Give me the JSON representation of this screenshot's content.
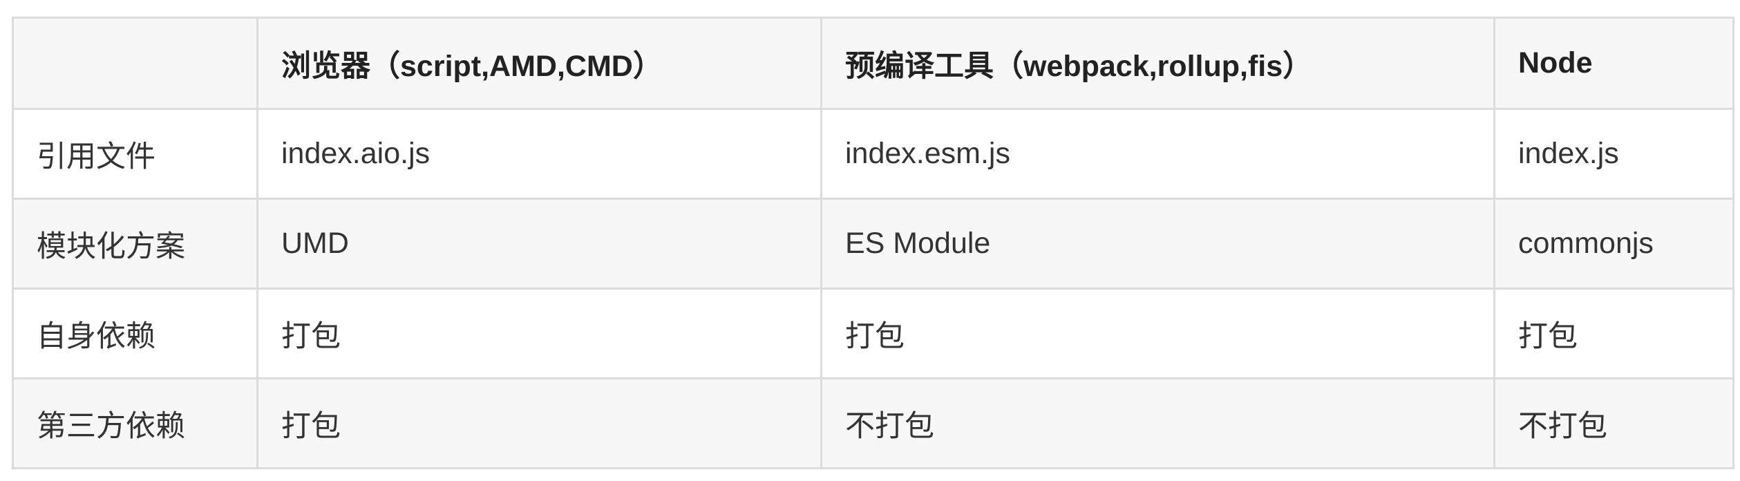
{
  "table": {
    "headers": [
      "",
      "浏览器（script,AMD,CMD）",
      "预编译工具（webpack,rollup,fis）",
      "Node"
    ],
    "rows": [
      [
        "引用文件",
        "index.aio.js",
        "index.esm.js",
        "index.js"
      ],
      [
        "模块化方案",
        "UMD",
        "ES Module",
        "commonjs"
      ],
      [
        "自身依赖",
        "打包",
        "打包",
        "打包"
      ],
      [
        "第三方依赖",
        "打包",
        "不打包",
        "不打包"
      ]
    ]
  }
}
